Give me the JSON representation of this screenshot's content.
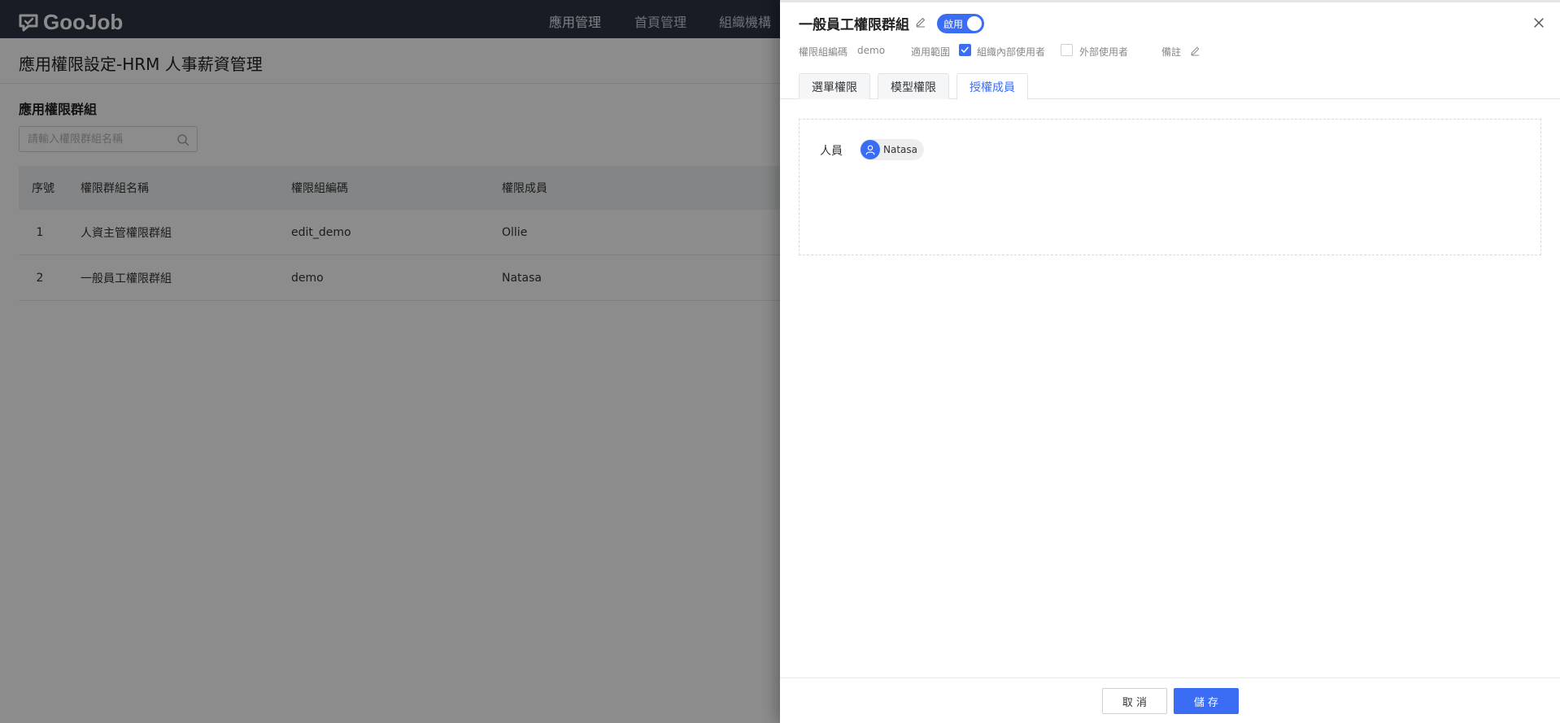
{
  "app": {
    "logo_text": "GooJob",
    "nav": [
      "應用管理",
      "首頁管理",
      "組織機構"
    ],
    "page_title": "應用權限設定-HRM 人事薪資管理",
    "section_title": "應用權限群組",
    "search": {
      "placeholder": "請輸入權限群組名稱",
      "value": ""
    },
    "table": {
      "headers": [
        "序號",
        "權限群組名稱",
        "權限組編碼",
        "權限成員"
      ],
      "rows": [
        [
          "1",
          "人資主管權限群組",
          "edit_demo",
          "Ollie"
        ],
        [
          "2",
          "一般員工權限群組",
          "demo",
          "Natasa"
        ]
      ]
    }
  },
  "drawer": {
    "title": "一般員工權限群組",
    "toggle_label": "啟用",
    "toggle_on": true,
    "code_label": "權限組編碼",
    "code_value": "demo",
    "scope_label": "適用範圍",
    "scope_options": [
      {
        "label": "組織內部使用者",
        "checked": true
      },
      {
        "label": "外部使用者",
        "checked": false
      }
    ],
    "remark_label": "備註",
    "tabs": [
      "選單權限",
      "模型權限",
      "授權成員"
    ],
    "active_tab": 2,
    "members_label": "人員",
    "members": [
      "Natasa"
    ],
    "buttons": {
      "cancel": "取 消",
      "save": "儲 存"
    }
  },
  "colors": {
    "primary": "#3b6cf4",
    "topbar": "#2b3444"
  }
}
